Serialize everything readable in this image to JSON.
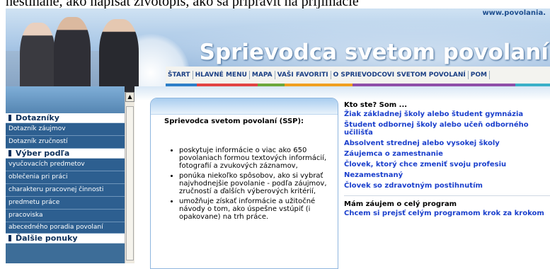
{
  "top_strip": {
    "text": "nestihane, ako napisat zivotopis, ako sa pripravit na prijimacie"
  },
  "header": {
    "url": "www.povolania.",
    "title": "Sprievodca svetom povolaní"
  },
  "nav": {
    "items": [
      {
        "label": "ŠTART"
      },
      {
        "label": "HLAVNÉ MENU"
      },
      {
        "label": "MAPA"
      },
      {
        "label": "VAŠI FAVORITI"
      },
      {
        "label": "O SPRIEVODCOVI SVETOM POVOLANÍ"
      },
      {
        "label": "POM"
      }
    ],
    "color_bars": [
      "#2d7fc8",
      "#e24444",
      "#6da83d",
      "#f0a020",
      "#8f4fa8",
      "#3ab0c8"
    ]
  },
  "sidebar": {
    "sections": [
      {
        "title": "Dotazníky",
        "items": [
          "Dotazník záujmov",
          "Dotazník zručností"
        ]
      },
      {
        "title": "Výber podľa",
        "items": [
          "vyučovacích predmetov",
          "oblečenia pri práci",
          "charakteru pracovnej činnosti",
          "predmetu práce",
          "pracoviska",
          "abecedného poradia povolaní"
        ]
      },
      {
        "title": "Ďalšie ponuky",
        "items": []
      }
    ]
  },
  "infobox": {
    "title": "Sprievodca svetom povolaní (SSP):",
    "bullets": [
      "poskytuje informácie o viac ako 650 povolaniach formou textových informácií, fotografií a zvukových záznamov,",
      "ponúka niekoľko spôsobov, ako si vybrať najvhodnejšie povolanie - podľa záujmov, zručností a ďalších výberových kritérií,",
      "umožňuje získať informácie a užitočné návody o tom, ako úspešne vstúpiť (i opakovane) na trh práce."
    ]
  },
  "who": {
    "heading": "Kto ste? Som ...",
    "links": [
      "Žiak základnej školy alebo študent gymnázia",
      "Študent odbornej školy alebo učeň odborného učilišťa",
      "Absolvent strednej alebo vysokej školy",
      "Záujemca o zamestnanie",
      "Človek, ktorý chce zmeniť svoju profesiu",
      "Nezamestnaný",
      "Človek so zdravotným postihnutím"
    ],
    "program_heading": "Mám záujem o celý program",
    "program_link": "Chcem si prejsť celým programom krok za krokom"
  }
}
